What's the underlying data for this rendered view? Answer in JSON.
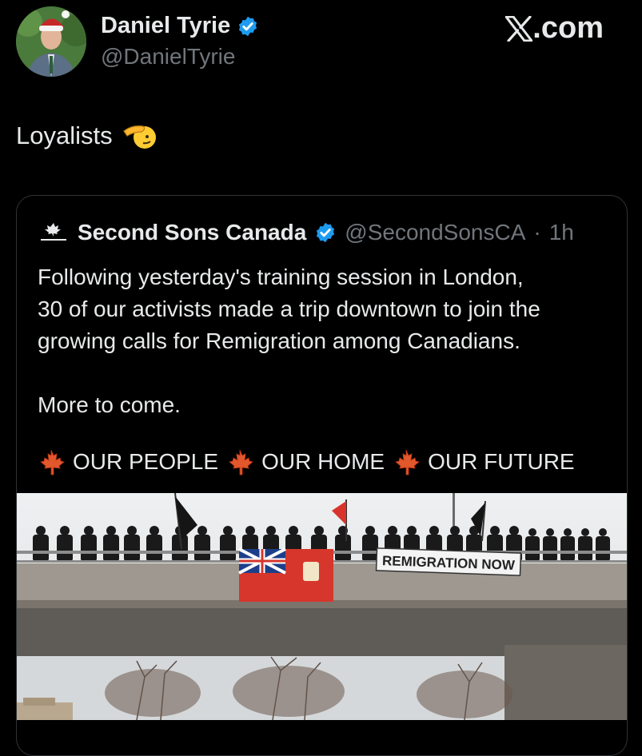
{
  "author": {
    "name": "Daniel Tyrie",
    "handle": "@DanielTyrie"
  },
  "site": {
    "logo_text": ".com"
  },
  "post": {
    "text": "Loyalists",
    "emoji": "saluting-hand-icon"
  },
  "quoted": {
    "name": "Second Sons Canada",
    "handle": "@SecondSonsCA",
    "separator": "·",
    "time": "1h",
    "body": [
      "Following yesterday's training session in London,",
      "30 of our activists made a trip downtown to join the",
      "growing calls for Remigration among Canadians."
    ],
    "body_2": "More to come.",
    "slogan": [
      "OUR PEOPLE",
      "OUR HOME",
      "OUR FUTURE"
    ],
    "banner_text": "REMIGRATION NOW"
  },
  "colors": {
    "background": "#000000",
    "text": "#e7e9ea",
    "muted": "#71767b",
    "verified": "#1d9bf0",
    "border": "#2f3336"
  }
}
